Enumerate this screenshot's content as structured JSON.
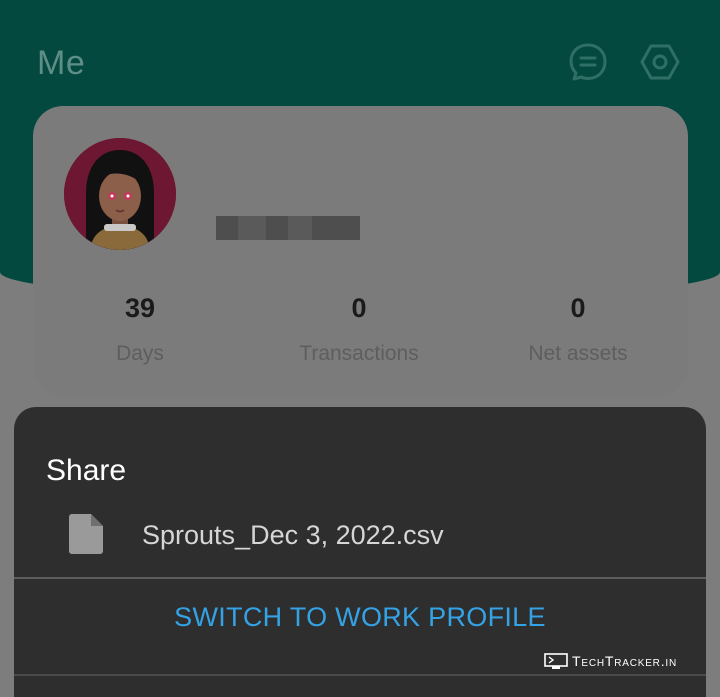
{
  "header": {
    "title": "Me",
    "icons": [
      "chat-icon",
      "settings-icon"
    ],
    "bg_color": "#03493f"
  },
  "profile": {
    "name_redacted": true,
    "stats": [
      {
        "value": "39",
        "label": "Days"
      },
      {
        "value": "0",
        "label": "Transactions"
      },
      {
        "value": "0",
        "label": "Net assets"
      }
    ]
  },
  "share_sheet": {
    "title": "Share",
    "file_icon": "file-icon",
    "file_name": "Sprouts_Dec 3, 2022.csv",
    "switch_label": "SWITCH TO WORK PROFILE",
    "accent_color": "#34a3e6"
  },
  "watermark": {
    "text": "TechTracker.in"
  }
}
